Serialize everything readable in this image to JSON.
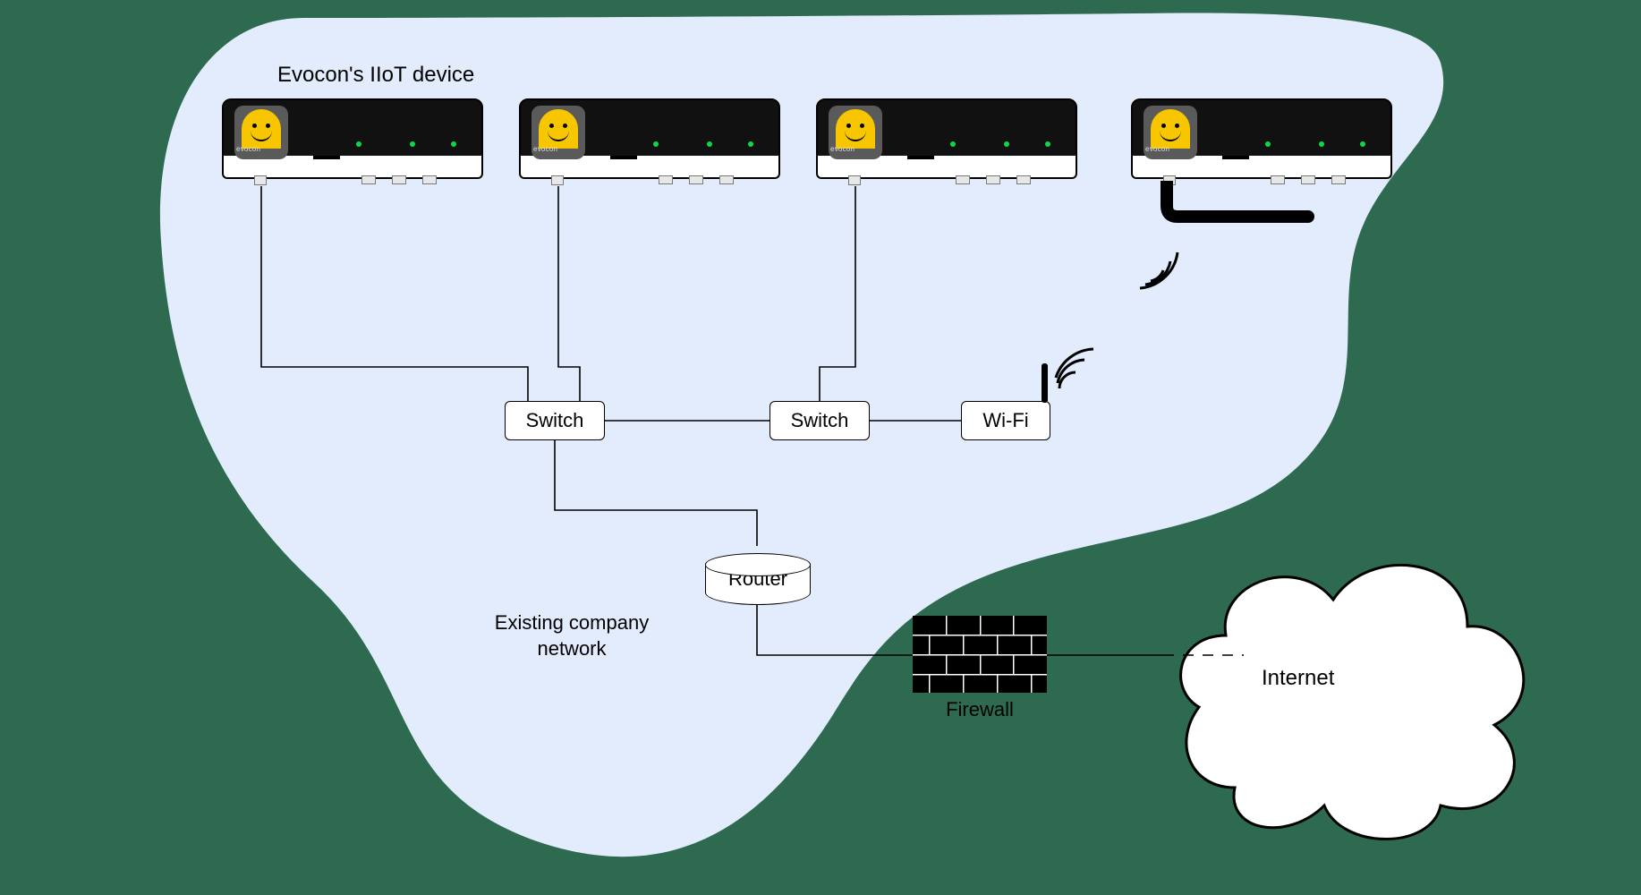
{
  "diagram": {
    "title": "Evocon's IIoT device",
    "network_label_line1": "Existing company",
    "network_label_line2": "network",
    "device_brand": "evocon",
    "nodes": {
      "switch1": "Switch",
      "switch2": "Switch",
      "wifi": "Wi-Fi",
      "router": "Router",
      "firewall": "Firewall",
      "internet": "Internet"
    },
    "devices_count": 4,
    "connections": [
      "device1 → switch1",
      "device2 → switch1",
      "device3 → switch2",
      "device4 → wifi (wireless)",
      "switch1 → switch2",
      "switch2 → wifi",
      "switch1 → router",
      "router → firewall",
      "firewall → internet"
    ],
    "colors": {
      "background": "#2d6a4f",
      "blob": "#e3ecfc",
      "device_body": "#111111",
      "device_accent": "#f7c600",
      "led": "#0bd84a"
    }
  }
}
